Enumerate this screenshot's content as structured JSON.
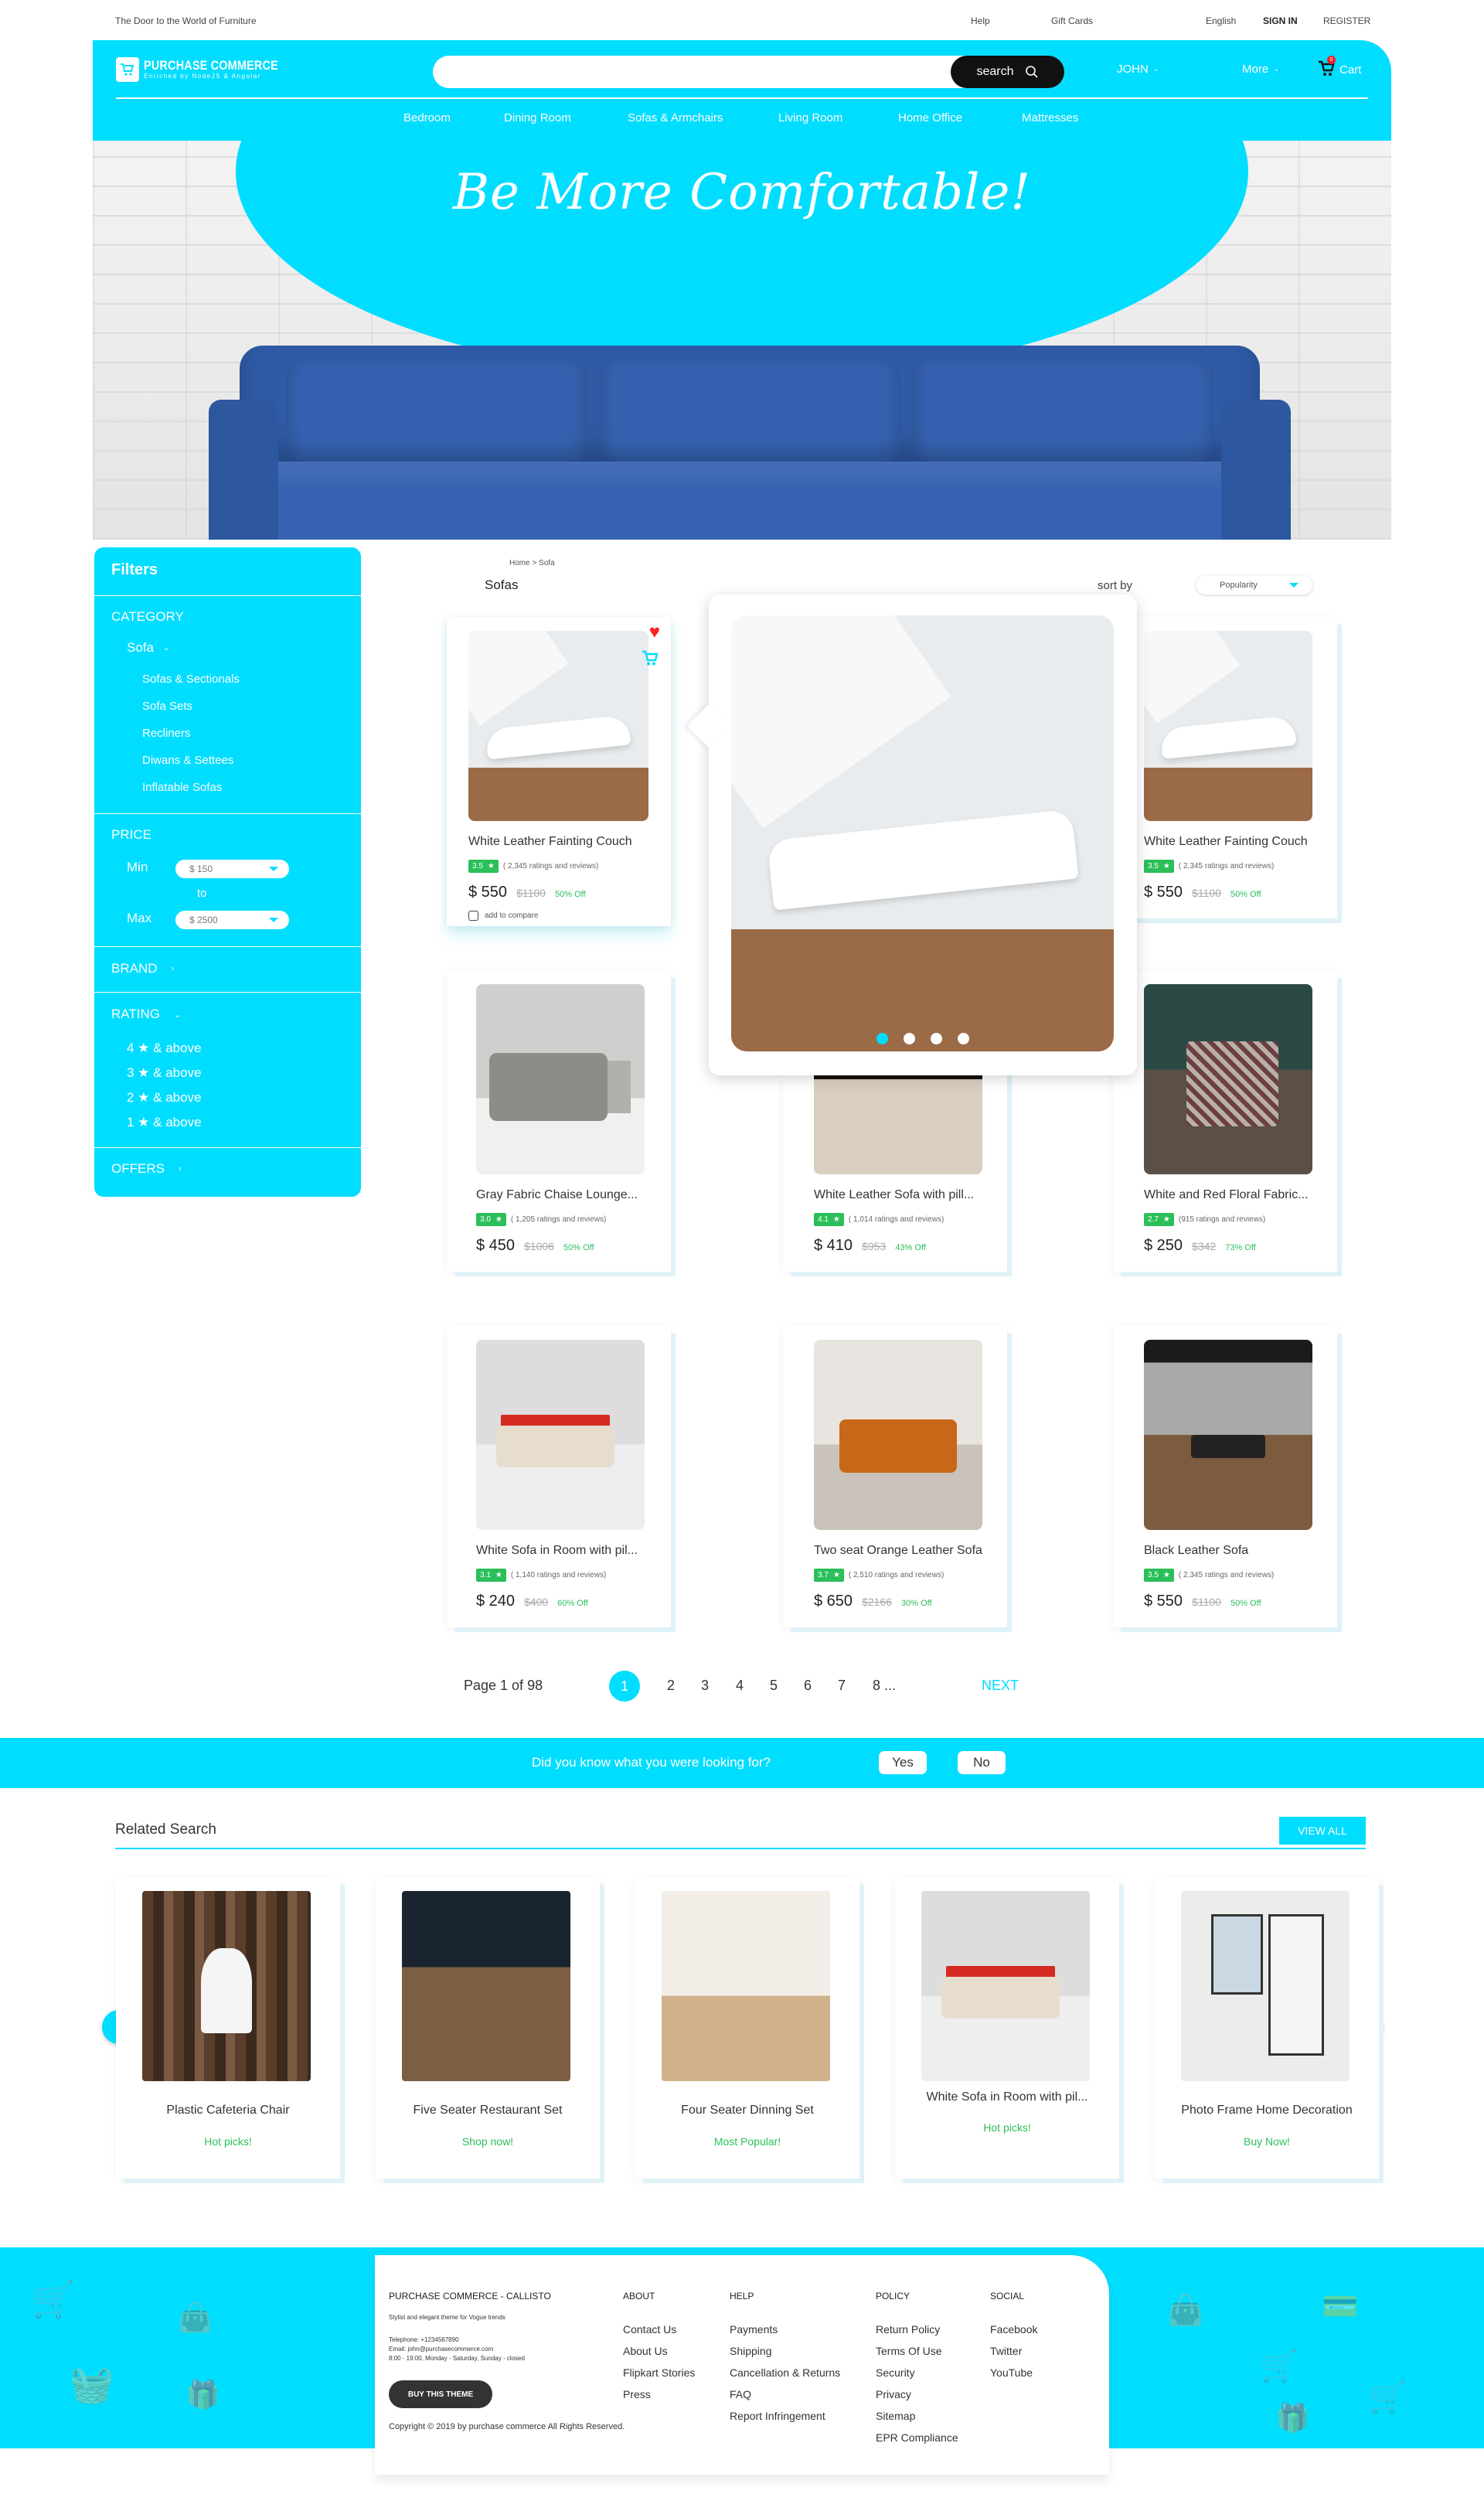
{
  "topbar": {
    "tagline": "The Door to the World of Furniture",
    "help": "Help",
    "gift_cards": "Gift Cards",
    "language": "English",
    "sign_in": "SIGN IN",
    "register": "REGISTER"
  },
  "header": {
    "brand": "PURCHASE COMMERCE",
    "brand_sub": "Enriched by NodeJS & Angular",
    "search_placeholder": "",
    "search_label": "search",
    "user": "JOHN",
    "more": "More",
    "cart": "Cart",
    "cart_count": "0",
    "categories": [
      "Bedroom",
      "Dining Room",
      "Sofas & Armchairs",
      "Living Room",
      "Home Office",
      "Mattresses"
    ]
  },
  "hero": {
    "title": "Be More Comfortable!"
  },
  "filters": {
    "title": "Filters",
    "category_label": "CATEGORY",
    "category_selected": "Sofa",
    "subcategories": [
      "Sofas & Sectionals",
      "Sofa Sets",
      "Recliners",
      "Diwans & Settees",
      "Inflatable Sofas"
    ],
    "price_label": "PRICE",
    "min_label": "Min",
    "min_value": "$  150",
    "to_label": "to",
    "max_label": "Max",
    "max_value": "$  2500",
    "brand_label": "BRAND",
    "rating_label": "RATING",
    "ratings": [
      "4 ★  & above",
      "3 ★  & above",
      "2 ★  & above",
      "1 ★  & above"
    ],
    "offers_label": "OFFERS"
  },
  "listing": {
    "breadcrumb": "Home  >  Sofa",
    "title": "Sofas",
    "sort_label": "sort by",
    "sort_value": "Popularity",
    "compare_label": "add to compare",
    "products": [
      {
        "name": "White Leather Fainting Couch",
        "rating": "3.5",
        "reviews": "( 2,345 ratings and reviews)",
        "price": "$ 550",
        "original": "$1100",
        "discount": "50% Off"
      },
      {
        "name": "White Leather Fainting Couch",
        "rating": "3.5",
        "reviews": "( 2,345 ratings and reviews)",
        "price": "$ 550",
        "original": "$1100",
        "discount": "50% Off"
      },
      {
        "name": "Gray Fabric Chaise Lounge...",
        "rating": "3.0",
        "reviews": "( 1,205 ratings and reviews)",
        "price": "$ 450",
        "original": "$1006",
        "discount": "50% Off"
      },
      {
        "name": "White Leather Sofa with pill...",
        "rating": "4.1",
        "reviews": "( 1,014 ratings and reviews)",
        "price": "$ 410",
        "original": "$953",
        "discount": "43% Off"
      },
      {
        "name": "White and Red Floral Fabric...",
        "rating": "2.7",
        "reviews": "(915 ratings and reviews)",
        "price": "$ 250",
        "original": "$342",
        "discount": "73% Off"
      },
      {
        "name": "White Sofa in Room with pil...",
        "rating": "3.1",
        "reviews": "( 1,140 ratings and reviews)",
        "price": "$ 240",
        "original": "$400",
        "discount": "60% Off"
      },
      {
        "name": "Two seat Orange Leather Sofa",
        "rating": "3.7",
        "reviews": "( 2,510 ratings and reviews)",
        "price": "$ 650",
        "original": "$2166",
        "discount": "30% Off"
      },
      {
        "name": "Black Leather Sofa",
        "rating": "3.5",
        "reviews": "( 2,345 ratings and reviews)",
        "price": "$ 550",
        "original": "$1100",
        "discount": "50% Off"
      }
    ]
  },
  "quickview": {
    "slides": 4,
    "active_slide": 1
  },
  "pagination": {
    "label": "Page   1 of 98",
    "pages": [
      "1",
      "2",
      "3",
      "4",
      "5",
      "6",
      "7",
      "8 ..."
    ],
    "current": "1",
    "next": "NEXT"
  },
  "feedback": {
    "question": "Did you know what you were looking for?",
    "yes": "Yes",
    "no": "No"
  },
  "related": {
    "title": "Related Search",
    "view_all": "VIEW ALL",
    "items": [
      {
        "name": "Plastic Cafeteria Chair",
        "tag": "Hot picks!"
      },
      {
        "name": "Five Seater Restaurant Set",
        "tag": "Shop now!"
      },
      {
        "name": "Four Seater Dinning Set",
        "tag": "Most Popular!"
      },
      {
        "name": "White Sofa in Room with pil...",
        "tag": "Hot picks!"
      },
      {
        "name": "Photo Frame Home Decoration",
        "tag": "Buy Now!"
      }
    ]
  },
  "footer": {
    "brand": "PURCHASE COMMERCE - CALLISTO",
    "desc": "Stylist and elegant theme for Vogue trends",
    "telephone": "Telephone: +1234567890",
    "email": "Email: john@purchasecommerce.com",
    "hours": "8:00 - 19:00, Monday - Saturday, Sunday - closed",
    "buy": "BUY THIS THEME",
    "copyright": "Copyright © 2019 by purchase commerce All Rights Reserved.",
    "columns": [
      {
        "heading": "ABOUT",
        "links": [
          "Contact Us",
          "About Us",
          "Flipkart Stories",
          "Press"
        ]
      },
      {
        "heading": "HELP",
        "links": [
          "Payments",
          "Shipping",
          "Cancellation & Returns",
          "FAQ",
          "Report Infringement"
        ]
      },
      {
        "heading": "POLICY",
        "links": [
          "Return Policy",
          "Terms Of Use",
          "Security",
          "Privacy",
          "Sitemap",
          "EPR Compliance"
        ]
      },
      {
        "heading": "SOCIAL",
        "links": [
          "Facebook",
          "Twitter",
          "YouTube"
        ]
      }
    ]
  },
  "colors": {
    "accent": "#00ddff",
    "rating_green": "#2bbf5a",
    "dark": "#333333",
    "heart": "#ff2222"
  }
}
